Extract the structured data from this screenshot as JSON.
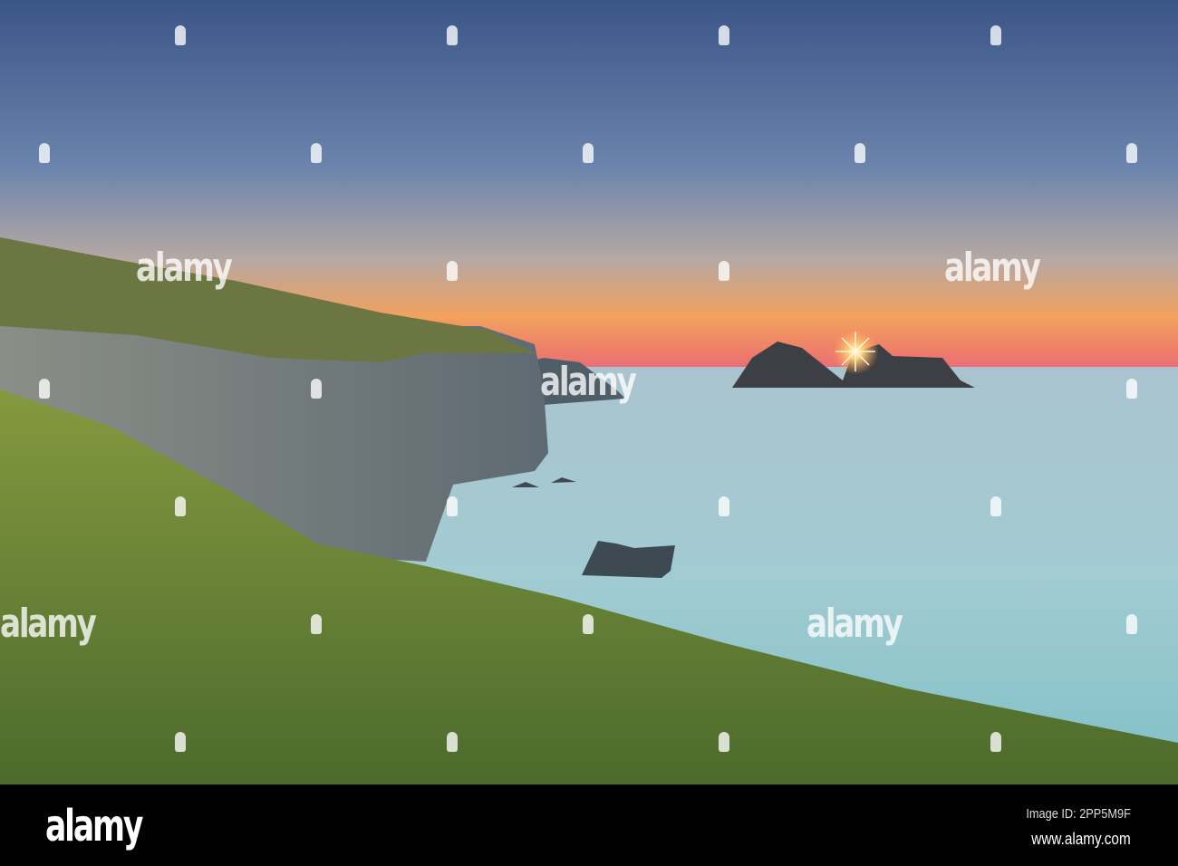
{
  "watermark": {
    "text": "alamy"
  },
  "footer": {
    "logo": "alamy",
    "image_id": "Image ID: 2PP5M9F",
    "website": "www.alamy.com"
  },
  "colors": {
    "sky_top": "#3f5c8c",
    "horizon": "#f09a5e",
    "sea": "#9fc6cd",
    "grass": "#6f8a3a",
    "bar": "#000000"
  }
}
